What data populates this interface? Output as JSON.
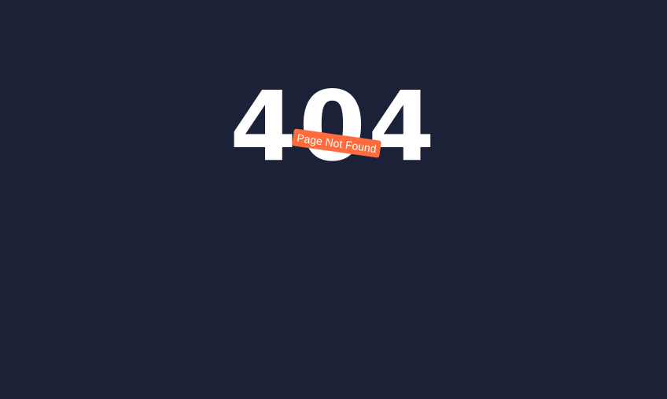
{
  "error": {
    "code": "404",
    "message": "Page Not Found"
  },
  "colors": {
    "background": "#1b2238",
    "code_text": "#ffffff",
    "ribbon": "#ff6b3d",
    "ribbon_text": "#ffffff"
  }
}
